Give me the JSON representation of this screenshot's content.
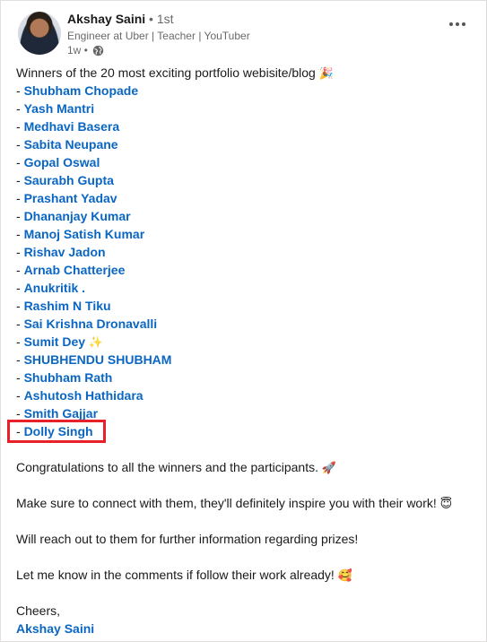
{
  "author": {
    "name": "Akshay Saini",
    "degree": "• 1st",
    "headline": "Engineer at Uber | Teacher | YouTuber",
    "time": "1w •"
  },
  "post": {
    "intro": "Winners of the 20 most exciting portfolio webisite/blog",
    "intro_emoji": "🎉",
    "dash": "- ",
    "winners": [
      {
        "name": "Shubham Chopade",
        "emoji": ""
      },
      {
        "name": "Yash Mantri",
        "emoji": ""
      },
      {
        "name": "Medhavi Basera",
        "emoji": ""
      },
      {
        "name": "Sabita Neupane",
        "emoji": ""
      },
      {
        "name": "Gopal Oswal",
        "emoji": ""
      },
      {
        "name": "Saurabh Gupta",
        "emoji": ""
      },
      {
        "name": "Prashant Yadav",
        "emoji": ""
      },
      {
        "name": "Dhananjay Kumar",
        "emoji": ""
      },
      {
        "name": "Manoj Satish Kumar",
        "emoji": ""
      },
      {
        "name": "Rishav Jadon",
        "emoji": ""
      },
      {
        "name": "Arnab Chatterjee",
        "emoji": ""
      },
      {
        "name": "Anukritik .",
        "emoji": ""
      },
      {
        "name": "Rashim N Tiku",
        "emoji": ""
      },
      {
        "name": "Sai Krishna Dronavalli",
        "emoji": ""
      },
      {
        "name": "Sumit Dey",
        "emoji": "✨"
      },
      {
        "name": "SHUBHENDU SHUBHAM",
        "emoji": ""
      },
      {
        "name": "Shubham Rath",
        "emoji": ""
      },
      {
        "name": "Ashutosh Hathidara",
        "emoji": ""
      },
      {
        "name": "Smith Gajjar",
        "emoji": ""
      },
      {
        "name": "Dolly Singh",
        "emoji": ""
      }
    ],
    "congrats": "Congratulations to all the winners and the participants.",
    "congrats_emoji": "🚀",
    "connect": "Make sure to connect with them, they'll definitely inspire you with their work!",
    "connect_emoji": "😇",
    "prizes": "Will reach out to them for further information regarding prizes!",
    "comments": "Let me know in the comments if follow their work already!",
    "comments_emoji": "🥰",
    "signoff": "Cheers,",
    "signature": "Akshay Saini"
  },
  "colors": {
    "link": "#0a66c2",
    "highlight": "#e8202a"
  },
  "icons": {
    "more": "more-options-icon",
    "globe": "globe-icon"
  }
}
